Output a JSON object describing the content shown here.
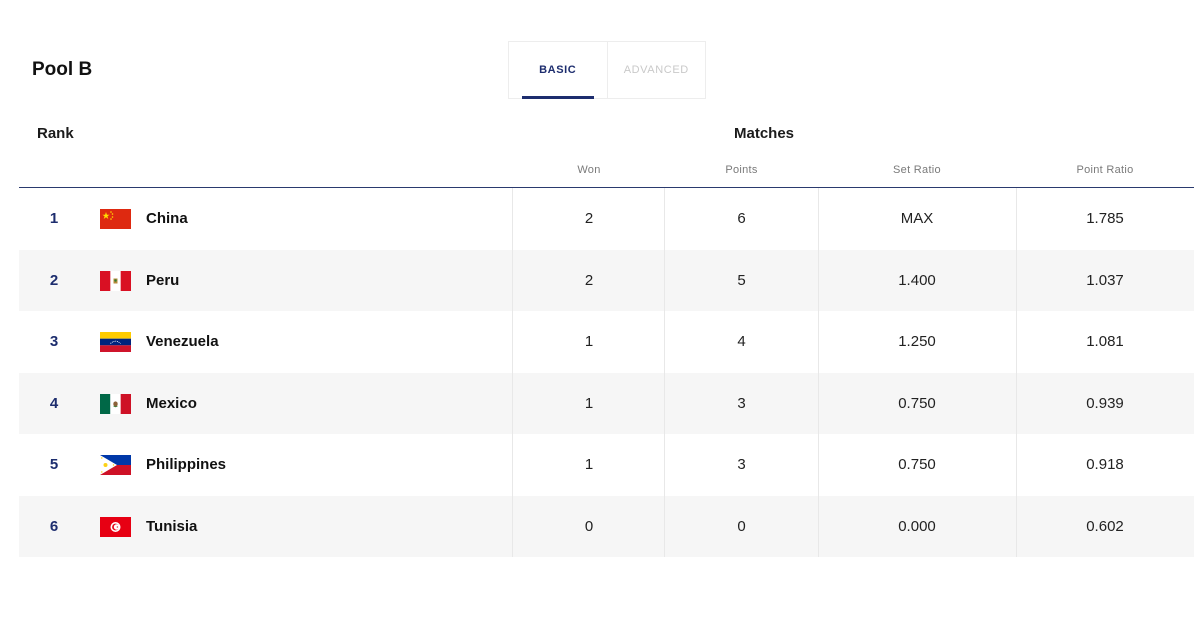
{
  "pool_title": "Pool B",
  "tabs": {
    "basic": "BASIC",
    "advanced": "ADVANCED"
  },
  "headers": {
    "rank": "Rank",
    "matches": "Matches",
    "won": "Won",
    "points": "Points",
    "set_ratio": "Set Ratio",
    "point_ratio": "Point Ratio"
  },
  "colors": {
    "accent": "#1d2d6e",
    "row_alt": "#f6f6f6"
  },
  "rows": [
    {
      "rank": "1",
      "team": "China",
      "flag": "china-flag-icon",
      "won": "2",
      "points": "6",
      "set_ratio": "MAX",
      "point_ratio": "1.785"
    },
    {
      "rank": "2",
      "team": "Peru",
      "flag": "peru-flag-icon",
      "won": "2",
      "points": "5",
      "set_ratio": "1.400",
      "point_ratio": "1.037"
    },
    {
      "rank": "3",
      "team": "Venezuela",
      "flag": "venezuela-flag-icon",
      "won": "1",
      "points": "4",
      "set_ratio": "1.250",
      "point_ratio": "1.081"
    },
    {
      "rank": "4",
      "team": "Mexico",
      "flag": "mexico-flag-icon",
      "won": "1",
      "points": "3",
      "set_ratio": "0.750",
      "point_ratio": "0.939"
    },
    {
      "rank": "5",
      "team": "Philippines",
      "flag": "philippines-flag-icon",
      "won": "1",
      "points": "3",
      "set_ratio": "0.750",
      "point_ratio": "0.918"
    },
    {
      "rank": "6",
      "team": "Tunisia",
      "flag": "tunisia-flag-icon",
      "won": "0",
      "points": "0",
      "set_ratio": "0.000",
      "point_ratio": "0.602"
    }
  ]
}
